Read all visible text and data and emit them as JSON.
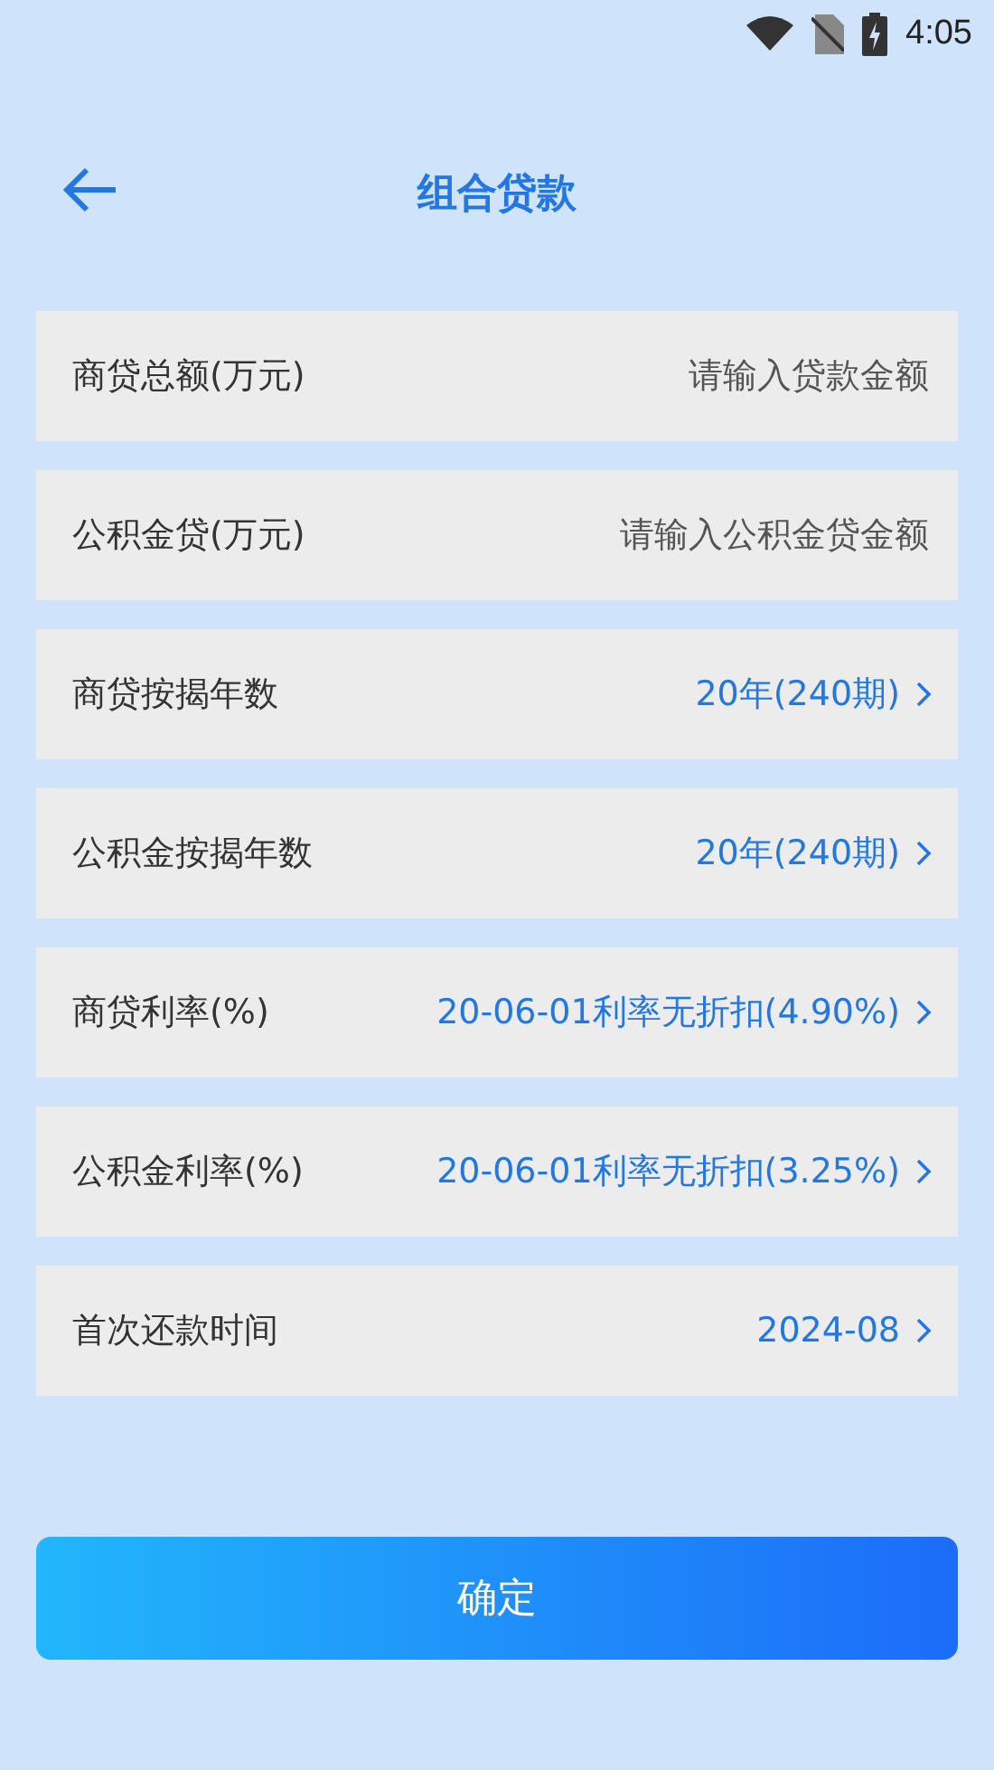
{
  "status_bar": {
    "time": "4:05"
  },
  "header": {
    "title": "组合贷款"
  },
  "rows": [
    {
      "kind": "input",
      "label": "商贷总额(万元)",
      "placeholder": "请输入贷款金额"
    },
    {
      "kind": "input",
      "label": "公积金贷(万元)",
      "placeholder": "请输入公积金贷金额"
    },
    {
      "kind": "select",
      "label": "商贷按揭年数",
      "value": "20年(240期)"
    },
    {
      "kind": "select",
      "label": "公积金按揭年数",
      "value": "20年(240期)"
    },
    {
      "kind": "select",
      "label": "商贷利率(%)",
      "value": "20-06-01利率无折扣(4.90%)"
    },
    {
      "kind": "select",
      "label": "公积金利率(%)",
      "value": "20-06-01利率无折扣(3.25%)"
    },
    {
      "kind": "select",
      "label": "首次还款时间",
      "value": "2024-08"
    }
  ],
  "confirm_button": "确定"
}
